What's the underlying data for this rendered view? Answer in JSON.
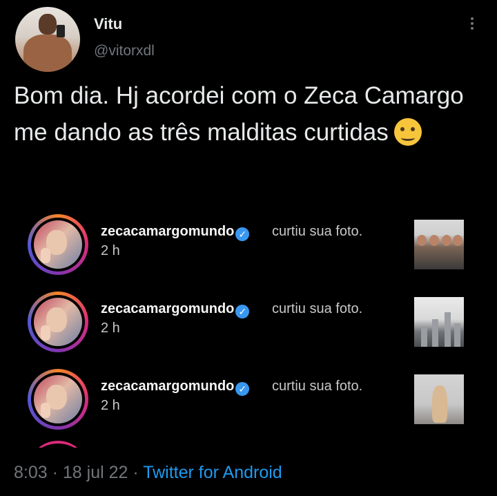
{
  "author": {
    "name": "Vitu",
    "handle": "@vitorxdl"
  },
  "tweet": {
    "text": "Bom dia. Hj acordei com o Zeca Camargo me dando as três malditas curtidas",
    "emoji": "woozy-face"
  },
  "notifications": [
    {
      "username": "zecacamargomundo",
      "action": "curtiu sua foto.",
      "time": "2 h"
    },
    {
      "username": "zecacamargomundo",
      "action": "curtiu sua foto.",
      "time": "2 h"
    },
    {
      "username": "zecacamargomundo",
      "action": "curtiu sua foto.",
      "time": "2 h"
    }
  ],
  "footer": {
    "time": "8:03",
    "date": "18 jul 22",
    "source": "Twitter for Android"
  },
  "colors": {
    "background": "#000000",
    "link": "#1d9bf0",
    "muted": "#71767b",
    "verified": "#3897f0"
  }
}
